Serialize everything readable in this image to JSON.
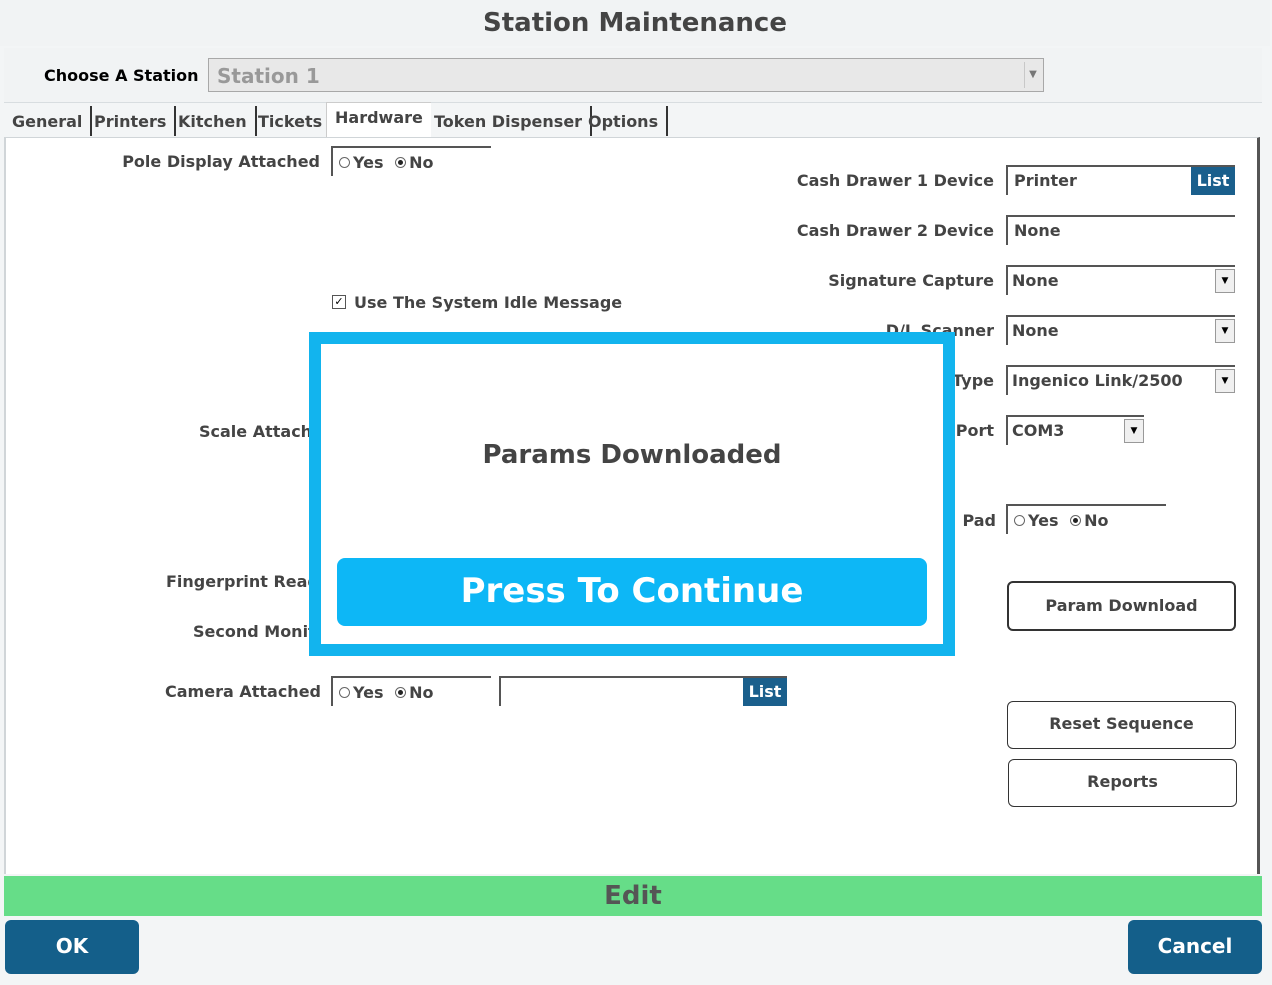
{
  "window": {
    "title": "Station Maintenance"
  },
  "station": {
    "label": "Choose A Station",
    "value": "Station 1"
  },
  "tabs": [
    "General",
    "Printers",
    "Kitchen",
    "Tickets",
    "Hardware",
    "Token Dispenser",
    "Options"
  ],
  "left": {
    "pole_display": {
      "label": "Pole Display Attached",
      "yes": "Yes",
      "no": "No",
      "selected": "No"
    },
    "idle_message": {
      "label": "Use The System Idle Message",
      "checked": true
    },
    "scale": {
      "label": "Scale Attached"
    },
    "fingerprint": {
      "label": "Fingerprint Reader"
    },
    "second_monitor": {
      "label": "Second Monitor"
    },
    "camera": {
      "label": "Camera Attached",
      "yes": "Yes",
      "no": "No",
      "selected": "No",
      "value": "",
      "list_label": "List"
    }
  },
  "right": {
    "cash_drawer1": {
      "label": "Cash Drawer 1 Device",
      "value": "Printer",
      "list_label": "List"
    },
    "cash_drawer2": {
      "label": "Cash Drawer 2 Device",
      "value": "None"
    },
    "signature": {
      "label": "Signature Capture",
      "value": "None"
    },
    "dl_scanner": {
      "label": "D/L Scanner",
      "value": "None"
    },
    "pin_type": {
      "label": "Type",
      "value": "Ingenico Link/2500"
    },
    "pin_port": {
      "label": "Port",
      "value": "COM3"
    },
    "pin_pad": {
      "label": "Pad",
      "yes": "Yes",
      "no": "No",
      "selected": "No"
    },
    "param_download": "Param Download",
    "reset_sequence": "Reset Sequence",
    "reports": "Reports"
  },
  "status_bar": "Edit",
  "footer": {
    "ok": "OK",
    "cancel": "Cancel"
  },
  "modal": {
    "message": "Params Downloaded",
    "button": "Press To Continue"
  },
  "colors": {
    "accent": "#145f8a",
    "modal_border": "#12b4ee",
    "edit_bar": "#66dd88"
  }
}
